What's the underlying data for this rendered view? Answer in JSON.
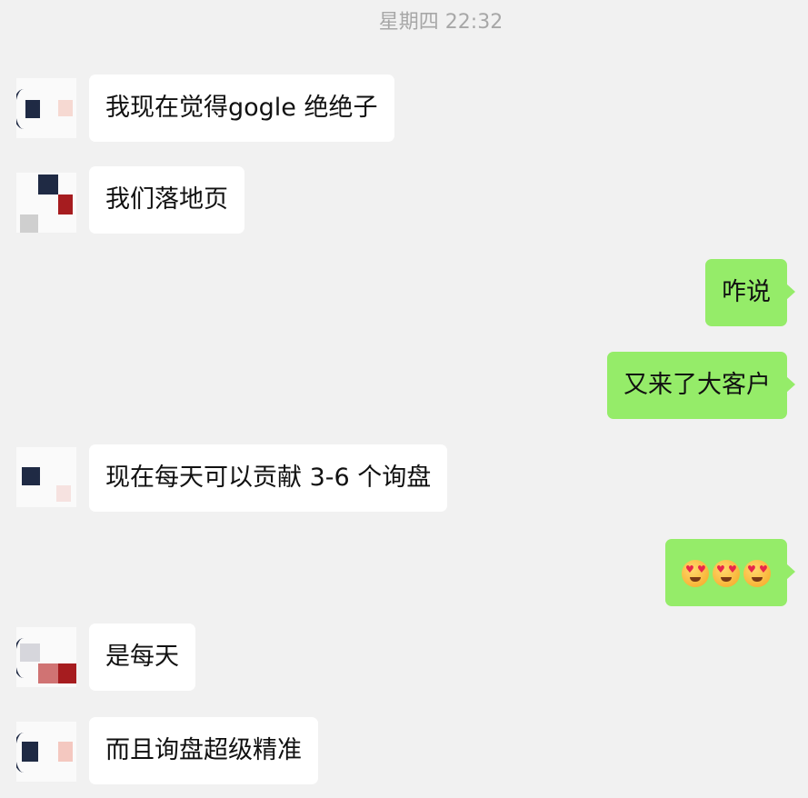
{
  "header": {
    "timestamp": "星期四 22:32"
  },
  "messages": [
    {
      "side": "in",
      "text": "我现在觉得gogle 绝绝子"
    },
    {
      "side": "in",
      "text": "我们落地页"
    },
    {
      "side": "out",
      "text": "咋说"
    },
    {
      "side": "out",
      "text": "又来了大客户"
    },
    {
      "side": "in",
      "text": "现在每天可以贡献 3-6 个询盘"
    },
    {
      "side": "out",
      "emoji": [
        "heart-eyes-emoji",
        "heart-eyes-emoji",
        "heart-eyes-emoji"
      ]
    },
    {
      "side": "in",
      "text": "是每天"
    },
    {
      "side": "in",
      "text": "而且询盘超级精准"
    }
  ],
  "colors": {
    "background": "#f1f1f1",
    "incoming_bubble": "#ffffff",
    "outgoing_bubble": "#95ec69",
    "timestamp_text": "#a7a7a7"
  }
}
